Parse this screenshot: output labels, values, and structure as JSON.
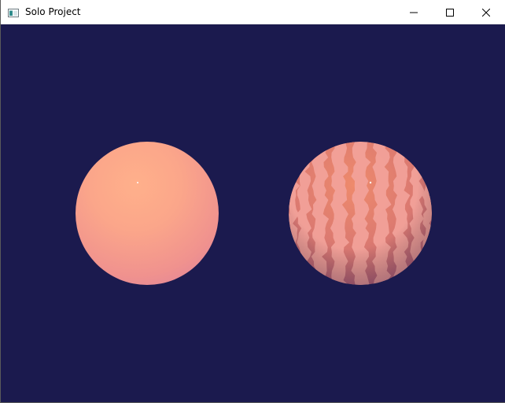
{
  "window": {
    "title": "Solo Project",
    "icon": "app-window-icon",
    "controls": [
      "minimize-icon",
      "maximize-icon",
      "close-icon"
    ]
  },
  "scene": {
    "background": "#1b1a4e",
    "spheres": [
      {
        "name": "plain-sphere",
        "color": "#fba68a"
      },
      {
        "name": "striped-sphere",
        "color": "#e8876e",
        "stripe_color": "#f4a59d"
      }
    ]
  }
}
